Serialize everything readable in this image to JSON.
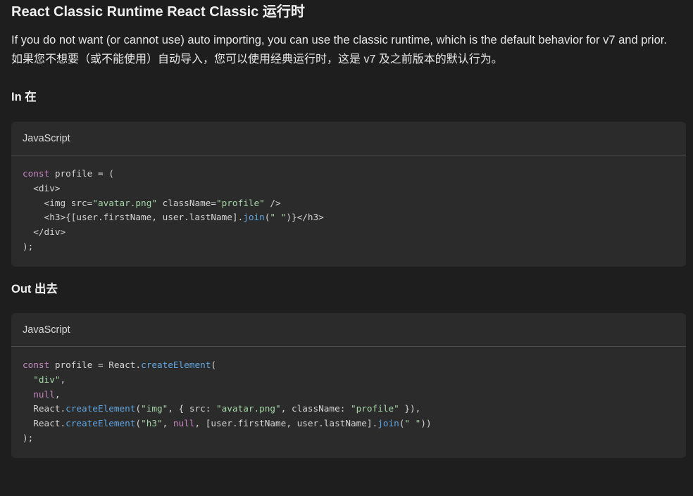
{
  "title": "React Classic Runtime  React Classic 运行时",
  "description_en": "If you do not want (or cannot use) auto importing, you can use the classic runtime, which is the default behavior for v7 and prior.",
  "description_zh": "如果您不想要（或不能使用）自动导入，您可以使用经典运行时，这是 v7 及之前版本的默认行为。",
  "sections": {
    "in": {
      "heading": "In  在",
      "code_language": "JavaScript",
      "code": {
        "l1_kw": "const",
        "l1_rest": " profile = (",
        "l2": "  <div>",
        "l3_a": "    <img src=",
        "l3_s1": "\"avatar.png\"",
        "l3_b": " className=",
        "l3_s2": "\"profile\"",
        "l3_c": " />",
        "l4_a": "    <h3>{[user.firstName, user.lastName].",
        "l4_fn": "join",
        "l4_b": "(",
        "l4_s": "\" \"",
        "l4_c": ")}</h3>",
        "l5": "  </div>",
        "l6": ");"
      }
    },
    "out": {
      "heading": "Out  出去",
      "code_language": "JavaScript",
      "code": {
        "l1_kw": "const",
        "l1_a": " profile = React.",
        "l1_fn": "createElement",
        "l1_b": "(",
        "l2_s": "\"div\"",
        "l2_b": ",",
        "l3_n": "null",
        "l3_b": ",",
        "l4_a": "  React.",
        "l4_fn": "createElement",
        "l4_b": "(",
        "l4_s1": "\"img\"",
        "l4_c": ", { src: ",
        "l4_s2": "\"avatar.png\"",
        "l4_d": ", className: ",
        "l4_s3": "\"profile\"",
        "l4_e": " }),",
        "l5_a": "  React.",
        "l5_fn1": "createElement",
        "l5_b": "(",
        "l5_s1": "\"h3\"",
        "l5_c": ", ",
        "l5_n": "null",
        "l5_d": ", [user.firstName, user.lastName].",
        "l5_fn2": "join",
        "l5_e": "(",
        "l5_s2": "\" \"",
        "l5_f": "))",
        "l6": ");"
      }
    }
  },
  "colors": {
    "background": "#1e1e1e",
    "code_background": "#2b2b2b",
    "keyword": "#c586c0",
    "string": "#a5d6a7",
    "function": "#61a5e0"
  }
}
